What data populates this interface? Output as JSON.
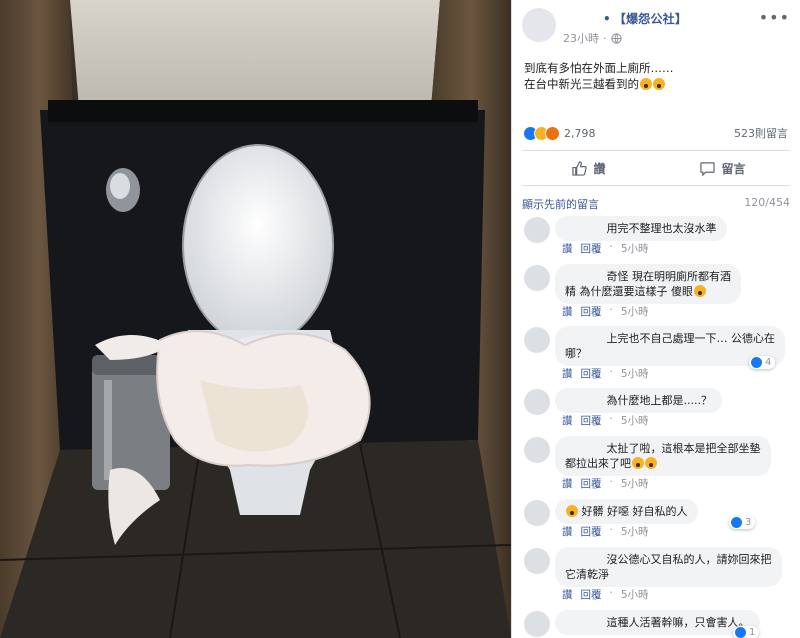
{
  "post": {
    "page_name": "【爆怨公社】",
    "time": "23小時",
    "text_line1": "到底有多怕在外面上廁所……",
    "text_line2": "在台中新光三越看到的",
    "reaction_count": "2,798",
    "comment_count": "523則留言"
  },
  "actions": {
    "like": "讚",
    "comment": "留言"
  },
  "comments_header": {
    "view_previous": "顯示先前的留言",
    "pager": "120/454"
  },
  "comment_actions": {
    "like": "讚",
    "reply": "回覆",
    "sep": "·"
  },
  "comments": [
    {
      "text": "用完不整理也太沒水準",
      "time": "5小時"
    },
    {
      "text_a": "奇怪 現在明明廁所都有酒",
      "text_b": "精 為什麼還要這樣子 傻眼",
      "time": "5小時"
    },
    {
      "text_a": "上完也不自己處理一下… 公德心在",
      "text_b": "哪？",
      "time": "5小時",
      "reactions": "4"
    },
    {
      "text": "為什麼地上都是.....？",
      "time": "5小時"
    },
    {
      "text_a": "太扯了啦，這根本是把全部坐墊",
      "text_b": "都拉出來了吧",
      "time": "5小時"
    },
    {
      "text": "好髒 好噁 好自私的人",
      "time": "5小時",
      "reactions": "3"
    },
    {
      "text_a": "沒公德心又自私的人，請妳回來把",
      "text_b": "它清乾淨",
      "time": "5小時"
    },
    {
      "text": "這種人活著幹嘛，只會害人。",
      "reactions": "1"
    }
  ],
  "colors": {
    "link": "#385898",
    "muted": "#90949c",
    "bubble": "#f2f3f5",
    "like_blue": "#1877f2"
  },
  "icons": [
    "globe-icon",
    "more-icon",
    "like-icon",
    "comment-icon",
    "reaction-like-icon",
    "reaction-wow-icon",
    "reaction-angry-icon"
  ]
}
